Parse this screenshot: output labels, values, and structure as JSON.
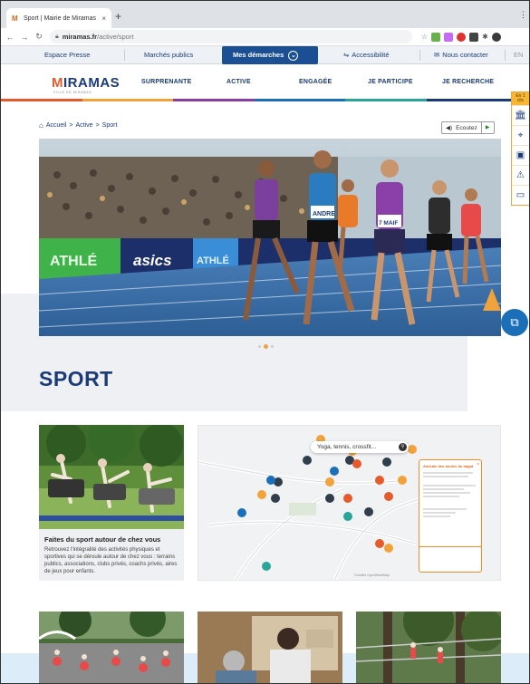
{
  "browser": {
    "tab_title": "Sport | Mairie de Miramas",
    "tab_close": "×",
    "new_tab": "+",
    "url_domain": "miramas.fr",
    "url_path": "/active/sport",
    "window_controls": "⋮"
  },
  "utility_bar": {
    "espace_presse": "Espace Presse",
    "marches_publics": "Marchés publics",
    "mes_demarches": "Mes démarches",
    "accessibilite": "Accessibilité",
    "nous_contacter": "Nous contacter",
    "lang": "EN"
  },
  "header": {
    "logo_text": "IRAMAS",
    "logo_initial": "M",
    "logo_tagline": "VILLE DE MIRAMAS",
    "nav": [
      "SURPRENANTE",
      "ACTIVE",
      "ENGAGÉE",
      "JE PARTICIPE",
      "JE RECHERCHE"
    ]
  },
  "side_tools": {
    "header": "En 1 clic"
  },
  "breadcrumb": {
    "items": [
      "Accueil",
      "Active",
      "Sport"
    ],
    "separator": ">"
  },
  "listen_button": {
    "label": "Ecoutez"
  },
  "hero": {
    "banner_text_1": "ATHLÉ",
    "banner_text_2": "asics",
    "banner_text_3": "ATHLÉ",
    "bib_1": "ANDRE",
    "bib_2": "7 MAIF",
    "bib_3": "MAIF"
  },
  "page": {
    "title": "SPORT"
  },
  "card_sport": {
    "title": "Faites du sport autour de chez vous",
    "description": "Retrouvez l'intégralité des activités physiques et sportives qui se déroule autour de chez vous : terrains publics, associations, clubs privés, coachs privés, aires de jeux pour enfants."
  },
  "map": {
    "search_placeholder": "Yoga, tennis, crossfit...",
    "popup_title": "Amicale des boules du bagat",
    "credit": "©Leaflet OpenStreetMap"
  },
  "colors": {
    "brand_blue": "#1b3a78",
    "accent_orange": "#e55b2b",
    "active_blue": "#1b4f94",
    "line_colors": [
      "#e55b2b",
      "#f2a23a",
      "#8a3fa0",
      "#1b6fb8",
      "#2aa59a",
      "#1b3a78"
    ]
  }
}
